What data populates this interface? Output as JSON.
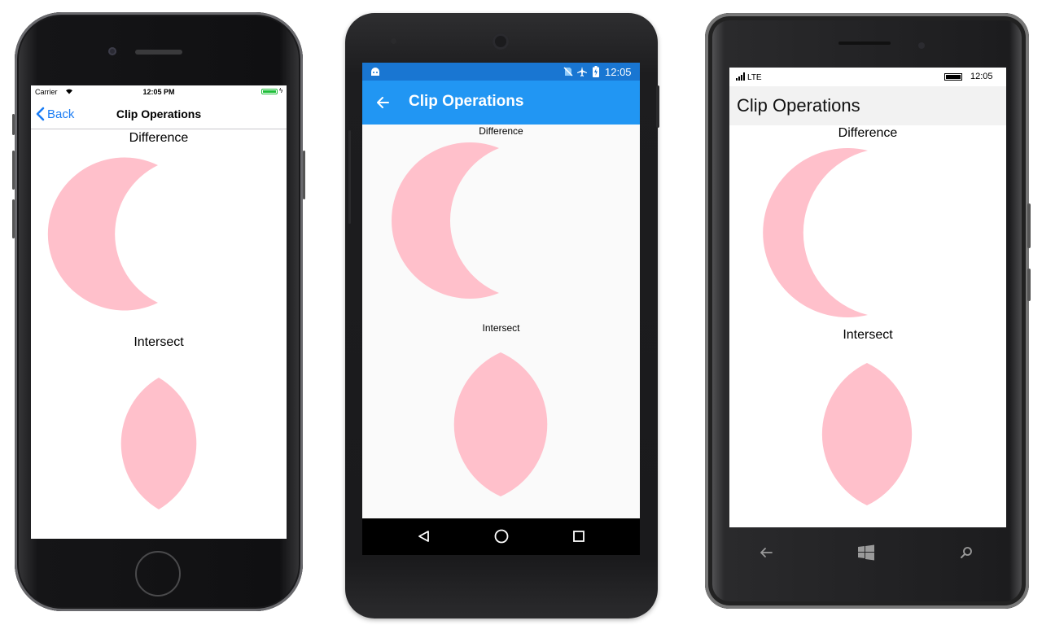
{
  "shape_color": "#ffc0cb",
  "ios": {
    "status": {
      "carrier": "Carrier",
      "time": "12:05 PM"
    },
    "nav": {
      "back_label": "Back",
      "title": "Clip Operations"
    },
    "labels": {
      "difference": "Difference",
      "intersect": "Intersect"
    }
  },
  "android": {
    "status": {
      "time": "12:05"
    },
    "toolbar": {
      "title": "Clip Operations"
    },
    "labels": {
      "difference": "Difference",
      "intersect": "Intersect"
    }
  },
  "winphone": {
    "status": {
      "network": "LTE",
      "time": "12:05"
    },
    "header": {
      "title": "Clip Operations"
    },
    "labels": {
      "difference": "Difference",
      "intersect": "Intersect"
    }
  }
}
